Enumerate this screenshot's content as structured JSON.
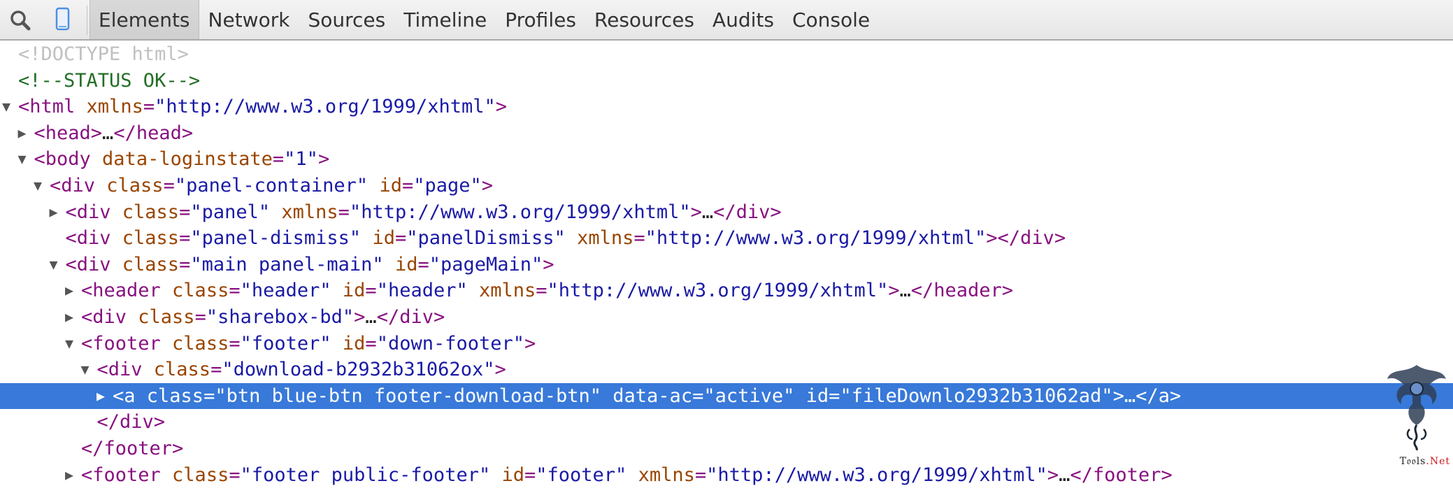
{
  "toolbar": {
    "search_icon": "search-icon",
    "device_icon": "device-mode-icon",
    "tabs": [
      "Elements",
      "Network",
      "Sources",
      "Timeline",
      "Profiles",
      "Resources",
      "Audits",
      "Console"
    ],
    "selected_tab": "Elements"
  },
  "tree": {
    "doctype": "<!DOCTYPE html>",
    "comment": "<!--STATUS OK-->",
    "lines": [
      {
        "indent": 0,
        "arrow": "expanded",
        "parts": [
          [
            "t",
            "<html "
          ],
          [
            "an",
            "xmlns"
          ],
          [
            "t",
            "="
          ],
          [
            "av",
            "\"http://www.w3.org/1999/xhtml\""
          ],
          [
            "t",
            ">"
          ]
        ]
      },
      {
        "indent": 1,
        "arrow": "collapsed",
        "parts": [
          [
            "t",
            "<head>"
          ],
          [
            "tx",
            "…"
          ],
          [
            "t",
            "</head>"
          ]
        ]
      },
      {
        "indent": 1,
        "arrow": "expanded",
        "parts": [
          [
            "t",
            "<body "
          ],
          [
            "an",
            "data-loginstate"
          ],
          [
            "t",
            "="
          ],
          [
            "av",
            "\"1\""
          ],
          [
            "t",
            ">"
          ]
        ]
      },
      {
        "indent": 2,
        "arrow": "expanded",
        "parts": [
          [
            "t",
            "<div "
          ],
          [
            "an",
            "class"
          ],
          [
            "t",
            "="
          ],
          [
            "av",
            "\"panel-container\""
          ],
          [
            "t",
            " "
          ],
          [
            "an",
            "id"
          ],
          [
            "t",
            "="
          ],
          [
            "av",
            "\"page\""
          ],
          [
            "t",
            ">"
          ]
        ]
      },
      {
        "indent": 3,
        "arrow": "collapsed",
        "parts": [
          [
            "t",
            "<div "
          ],
          [
            "an",
            "class"
          ],
          [
            "t",
            "="
          ],
          [
            "av",
            "\"panel\""
          ],
          [
            "t",
            " "
          ],
          [
            "an",
            "xmlns"
          ],
          [
            "t",
            "="
          ],
          [
            "av",
            "\"http://www.w3.org/1999/xhtml\""
          ],
          [
            "t",
            ">"
          ],
          [
            "tx",
            "…"
          ],
          [
            "t",
            "</div>"
          ]
        ]
      },
      {
        "indent": 3,
        "arrow": "none",
        "parts": [
          [
            "t",
            "<div "
          ],
          [
            "an",
            "class"
          ],
          [
            "t",
            "="
          ],
          [
            "av",
            "\"panel-dismiss\""
          ],
          [
            "t",
            " "
          ],
          [
            "an",
            "id"
          ],
          [
            "t",
            "="
          ],
          [
            "av",
            "\"panelDismiss\""
          ],
          [
            "t",
            " "
          ],
          [
            "an",
            "xmlns"
          ],
          [
            "t",
            "="
          ],
          [
            "av",
            "\"http://www.w3.org/1999/xhtml\""
          ],
          [
            "t",
            "></div>"
          ]
        ]
      },
      {
        "indent": 3,
        "arrow": "expanded",
        "parts": [
          [
            "t",
            "<div "
          ],
          [
            "an",
            "class"
          ],
          [
            "t",
            "="
          ],
          [
            "av",
            "\"main panel-main\""
          ],
          [
            "t",
            " "
          ],
          [
            "an",
            "id"
          ],
          [
            "t",
            "="
          ],
          [
            "av",
            "\"pageMain\""
          ],
          [
            "t",
            ">"
          ]
        ]
      },
      {
        "indent": 4,
        "arrow": "collapsed",
        "parts": [
          [
            "t",
            "<header "
          ],
          [
            "an",
            "class"
          ],
          [
            "t",
            "="
          ],
          [
            "av",
            "\"header\""
          ],
          [
            "t",
            " "
          ],
          [
            "an",
            "id"
          ],
          [
            "t",
            "="
          ],
          [
            "av",
            "\"header\""
          ],
          [
            "t",
            " "
          ],
          [
            "an",
            "xmlns"
          ],
          [
            "t",
            "="
          ],
          [
            "av",
            "\"http://www.w3.org/1999/xhtml\""
          ],
          [
            "t",
            ">"
          ],
          [
            "tx",
            "…"
          ],
          [
            "t",
            "</header>"
          ]
        ]
      },
      {
        "indent": 4,
        "arrow": "collapsed",
        "parts": [
          [
            "t",
            "<div "
          ],
          [
            "an",
            "class"
          ],
          [
            "t",
            "="
          ],
          [
            "av",
            "\"sharebox-bd\""
          ],
          [
            "t",
            ">"
          ],
          [
            "tx",
            "…"
          ],
          [
            "t",
            "</div>"
          ]
        ]
      },
      {
        "indent": 4,
        "arrow": "expanded",
        "parts": [
          [
            "t",
            "<footer "
          ],
          [
            "an",
            "class"
          ],
          [
            "t",
            "="
          ],
          [
            "av",
            "\"footer\""
          ],
          [
            "t",
            " "
          ],
          [
            "an",
            "id"
          ],
          [
            "t",
            "="
          ],
          [
            "av",
            "\"down-footer\""
          ],
          [
            "t",
            ">"
          ]
        ]
      },
      {
        "indent": 5,
        "arrow": "expanded",
        "parts": [
          [
            "t",
            "<div "
          ],
          [
            "an",
            "class"
          ],
          [
            "t",
            "="
          ],
          [
            "av",
            "\"download-b2932b31062ox\""
          ],
          [
            "t",
            ">"
          ]
        ]
      },
      {
        "indent": 6,
        "arrow": "collapsed",
        "selected": true,
        "parts": [
          [
            "t",
            "<a "
          ],
          [
            "an",
            "class"
          ],
          [
            "t",
            "="
          ],
          [
            "av",
            "\"btn blue-btn footer-download-btn\""
          ],
          [
            "t",
            " "
          ],
          [
            "an",
            "data-ac"
          ],
          [
            "t",
            "="
          ],
          [
            "av",
            "\"active\""
          ],
          [
            "t",
            " "
          ],
          [
            "an",
            "id"
          ],
          [
            "t",
            "="
          ],
          [
            "av",
            "\"fileDownlo2932b31062ad\""
          ],
          [
            "t",
            ">"
          ],
          [
            "tx",
            "…"
          ],
          [
            "t",
            "</a>"
          ]
        ]
      },
      {
        "indent": 5,
        "arrow": "none",
        "parts": [
          [
            "t",
            "</div>"
          ]
        ]
      },
      {
        "indent": 4,
        "arrow": "none",
        "parts": [
          [
            "t",
            "</footer>"
          ]
        ]
      },
      {
        "indent": 4,
        "arrow": "collapsed",
        "parts": [
          [
            "t",
            "<footer "
          ],
          [
            "an",
            "class"
          ],
          [
            "t",
            "="
          ],
          [
            "av",
            "\"footer public-footer\""
          ],
          [
            "t",
            " "
          ],
          [
            "an",
            "id"
          ],
          [
            "t",
            "="
          ],
          [
            "av",
            "\"footer\""
          ],
          [
            "t",
            " "
          ],
          [
            "an",
            "xmlns"
          ],
          [
            "t",
            "="
          ],
          [
            "av",
            "\"http://www.w3.org/1999/xhtml\""
          ],
          [
            "t",
            ">"
          ],
          [
            "tx",
            "…"
          ],
          [
            "t",
            "</footer>"
          ]
        ]
      }
    ]
  },
  "watermark": {
    "icon": "dragon-logo-icon",
    "text_main": "T𝔬𝔬ls",
    "text_accent": ".Net"
  }
}
